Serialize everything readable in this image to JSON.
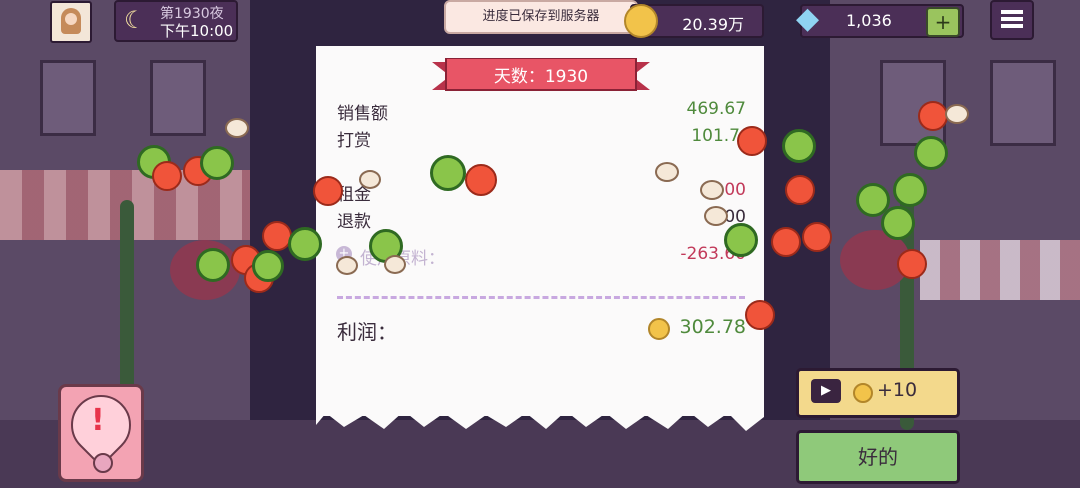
{
  "hud": {
    "night_label": "第1930夜",
    "time_label": "下午10:00",
    "toast": "进度已保存到服务器",
    "coins": "20.39万",
    "gems": "1,036",
    "add_label": "+"
  },
  "receipt": {
    "day_title": "天数：1930",
    "rows": [
      {
        "label": "销售额",
        "value": "469.67"
      },
      {
        "label": "打赏",
        "value": "101.7"
      },
      {
        "label": "租金",
        "value": ".00"
      },
      {
        "label": "退款",
        "value": "00"
      },
      {
        "label": "使用原料：",
        "value": "-263.60"
      }
    ],
    "profit_label": "利润：",
    "profit_value": "302.78"
  },
  "buttons": {
    "ad_reward": "+10",
    "ok": "好的"
  },
  "colors": {
    "positive": "#4f8a3c",
    "negative": "#c23a5a",
    "ribbon": "#e85566",
    "button_green": "#8fc97a",
    "button_tan": "#f3d98c"
  }
}
